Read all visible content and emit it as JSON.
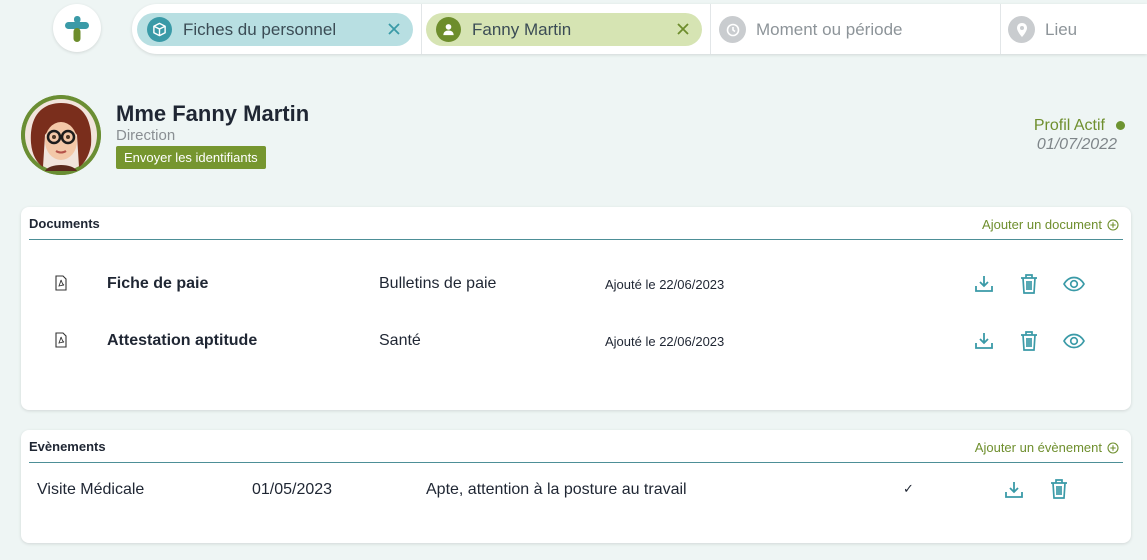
{
  "topbar": {
    "logo_icon": "cross-logo-icon",
    "filters": [
      {
        "label": "Fiches du personnel",
        "icon": "cube-icon",
        "removable": true
      },
      {
        "label": "Fanny Martin",
        "icon": "person-icon",
        "removable": true
      },
      {
        "label": "Moment ou période",
        "icon": "clock-icon",
        "removable": false
      },
      {
        "label": "Lieu",
        "icon": "map-pin-icon",
        "removable": false
      }
    ]
  },
  "profile": {
    "name": "Mme Fanny Martin",
    "role": "Direction",
    "send_credentials_label": "Envoyer les identifiants",
    "status_label": "Profil Actif",
    "status_date": "01/07/2022",
    "status_color": "#6d9431"
  },
  "documents": {
    "title": "Documents",
    "add_label": "Ajouter un document",
    "rows": [
      {
        "name": "Fiche de paie",
        "category": "Bulletins de paie",
        "date": "Ajouté le 22/06/2023"
      },
      {
        "name": "Attestation aptitude",
        "category": "Santé",
        "date": "Ajouté le 22/06/2023"
      }
    ]
  },
  "events": {
    "title": "Evènements",
    "add_label": "Ajouter un évènement",
    "rows": [
      {
        "name": "Visite Médicale",
        "date": "01/05/2023",
        "description": "Apte, attention à la posture au travail",
        "check": "✓"
      }
    ]
  },
  "colors": {
    "teal": "#3a9aa7",
    "olive": "#76962f",
    "background": "#eef5f4"
  }
}
